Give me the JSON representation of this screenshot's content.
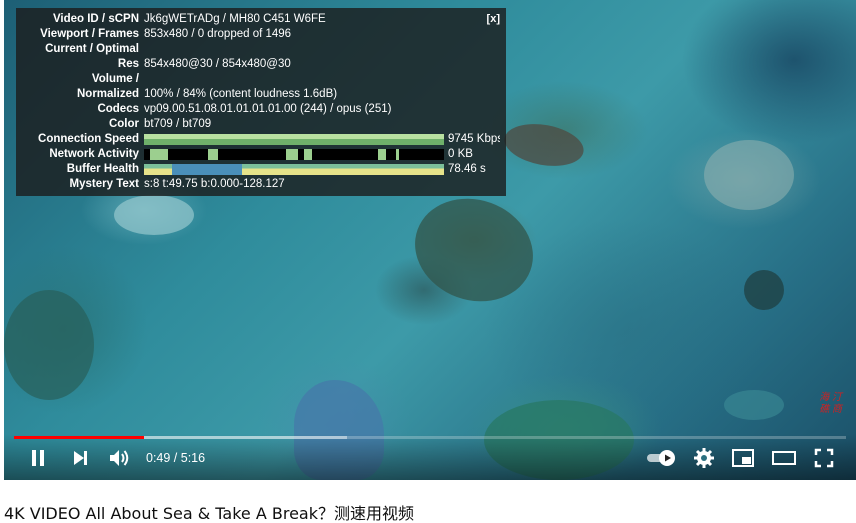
{
  "stats": {
    "close_label": "[x]",
    "rows": [
      {
        "label": "Video ID / sCPN",
        "value": "Jk6gWETrADg / MH80 C451 W6FE"
      },
      {
        "label": "Viewport / Frames",
        "value": "853x480 / 0 dropped of 1496"
      },
      {
        "label": "Current / Optimal",
        "value": ""
      },
      {
        "label": "Res",
        "value": "854x480@30 / 854x480@30"
      },
      {
        "label": "Volume /",
        "value": ""
      },
      {
        "label": "Normalized",
        "value": "100% / 84% (content loudness 1.6dB)"
      },
      {
        "label": "Codecs",
        "value": "vp09.00.51.08.01.01.01.01.00 (244) / opus (251)"
      },
      {
        "label": "Color",
        "value": "bt709 / bt709"
      }
    ],
    "connection_speed": {
      "label": "Connection Speed",
      "value": "9745 Kbps"
    },
    "network_activity": {
      "label": "Network Activity",
      "value": "0 KB"
    },
    "buffer_health": {
      "label": "Buffer Health",
      "value": "78.46 s"
    },
    "mystery_text": {
      "label": "Mystery Text",
      "value": "s:8 t:49.75 b:0.000-128.127"
    }
  },
  "watermark": {
    "line1": "海 汀",
    "line2": "礁 商"
  },
  "player": {
    "progress_played_fraction": 0.156,
    "progress_buffered_fraction": 0.4,
    "time_current": "0:49",
    "time_total": "5:16",
    "time_display": "0:49 / 5:16",
    "accent_color": "#ff0000",
    "icons": [
      "pause-icon",
      "next-icon",
      "volume-icon",
      "autoplay-toggle-icon",
      "settings-gear-icon",
      "miniplayer-icon",
      "theater-mode-icon",
      "fullscreen-icon"
    ]
  },
  "video_title": "4K VIDEO All About Sea & Take A Break？测速用视频"
}
